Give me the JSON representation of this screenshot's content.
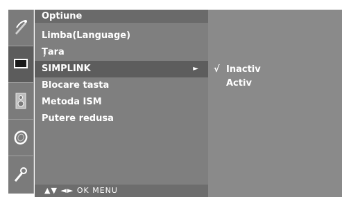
{
  "menu": {
    "title": "Optiune",
    "items": [
      {
        "label": "Limba(Language)"
      },
      {
        "label": "Țara"
      },
      {
        "label": "SIMPLINK"
      },
      {
        "label": "Blocare tasta"
      },
      {
        "label": "Metoda ISM"
      },
      {
        "label": "Putere redusa"
      }
    ],
    "selected_arrow": "►",
    "hint": "▲▼  ◄►  OK  MENU"
  },
  "submenu": {
    "items": [
      {
        "label": "Inactiv",
        "check": "√"
      },
      {
        "label": "Activ",
        "check": ""
      }
    ]
  },
  "icons": [
    "satellite-dish-icon",
    "tv-screen-icon",
    "speaker-icon",
    "clock-icon",
    "wrench-icon"
  ],
  "colors": {
    "icon_column": "#7b7b7b",
    "menu_bg": "#7f7f7f",
    "menu_title_bg": "#6a6a6a",
    "selected_row_bg": "#5d5d5d",
    "submenu_bg": "#8a8a8a"
  }
}
